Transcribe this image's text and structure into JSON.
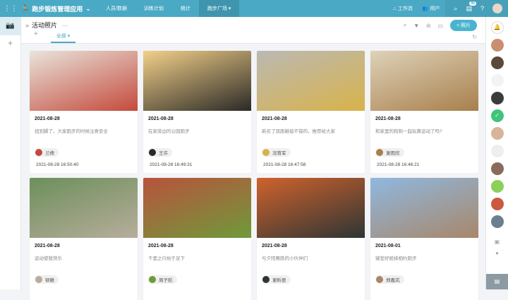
{
  "topbar": {
    "app_name": "跑步锻炼管理应用",
    "nav": [
      "人员/数据",
      "训练计划",
      "统计",
      "跑步广场"
    ],
    "workflow": "工作流",
    "users": "用户",
    "notification_count": "95"
  },
  "header": {
    "title": "活动照片",
    "tab_all": "全部",
    "add_photo": "+ 照片"
  },
  "cards": [
    {
      "date": "2021-08-28",
      "desc": "扭到脚了，大家跑步的时候注意安全",
      "user": "兰倚",
      "time": "2021-08-28 16:50:40",
      "c1": "#e9e4dc",
      "c2": "#c44a3c"
    },
    {
      "date": "2021-08-28",
      "desc": "在家旁边的公园跑步",
      "user": "王许",
      "time": "2021-08-28 16:49:31",
      "c1": "#f3d08a",
      "c2": "#2b2a26"
    },
    {
      "date": "2021-08-28",
      "desc": "新买了双跑鞋挺不错的，推荐给大家",
      "user": "况育军",
      "time": "2021-08-28 16:47:58",
      "c1": "#bbb9b3",
      "c2": "#d8b24a"
    },
    {
      "date": "2021-08-28",
      "desc": "和家里的狗狗一起玩算运动了吗?",
      "user": "谢雨欣",
      "time": "2021-08-28 16:46:21",
      "c1": "#ded2b8",
      "c2": "#a87f4c"
    },
    {
      "date": "2021-08-28",
      "desc": "运动使我快乐",
      "user": "顿雎",
      "c1": "#6d8f5b",
      "c2": "#b7ad9c"
    },
    {
      "date": "2021-08-28",
      "desc": "千里之行始于足下",
      "user": "周子航",
      "c1": "#b8533d",
      "c2": "#6f9a3a"
    },
    {
      "date": "2021-08-28",
      "desc": "与夕阳赛跑的小伙伴们",
      "user": "谢昕辰",
      "c1": "#d0622c",
      "c2": "#2d3535"
    },
    {
      "date": "2021-08-01",
      "desc": "寝室好姐妹相约跑步",
      "user": "郑嘉岚",
      "c1": "#8fb8e0",
      "c2": "#a8876a"
    }
  ]
}
